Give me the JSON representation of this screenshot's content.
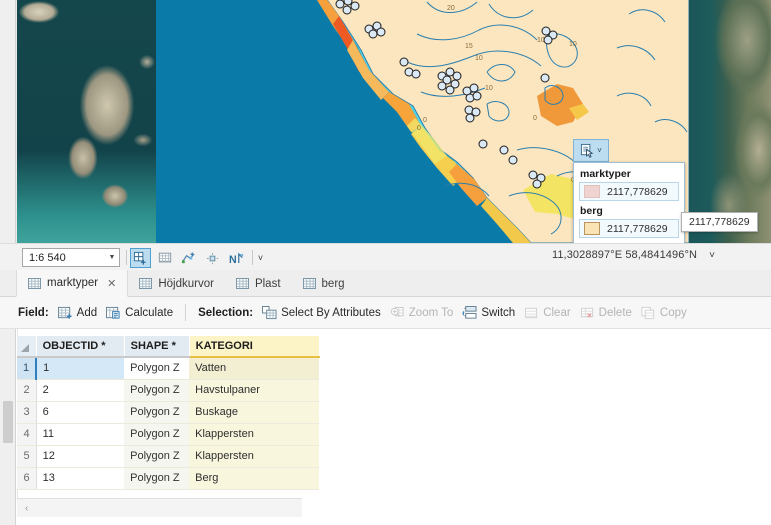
{
  "map": {
    "identify_button": {
      "icon": "identify-tool-icon",
      "caret": "˅"
    },
    "identify_panel": {
      "groups": [
        {
          "layer": "marktyper",
          "swatch_color": "#efd3d0",
          "value": "2117,778629"
        },
        {
          "layer": "berg",
          "swatch_color": "#fae3b4",
          "value": "2117,778629"
        }
      ]
    },
    "tooltip": "2117,778629",
    "contour_labels": [
      "20",
      "15",
      "10",
      "10",
      "10",
      "10",
      "0",
      "0",
      "0"
    ]
  },
  "status": {
    "scale": "1:6 540",
    "scale_dropdown_icon": "chevron-down-icon",
    "coordinates": "11,3028897°E 58,4841496°N",
    "coordinates_caret": "˅",
    "tools": [
      {
        "name": "select-features-tool",
        "active": true
      },
      {
        "name": "grid-tool",
        "active": false
      },
      {
        "name": "edit-vertices-tool",
        "active": false
      },
      {
        "name": "snapping-tool",
        "active": false
      },
      {
        "name": "north-arrow-tool",
        "active": false
      },
      {
        "name": "overflow-chevron",
        "active": false,
        "label": "˅"
      }
    ]
  },
  "table_tabs": [
    {
      "label": "marktyper",
      "active": true,
      "closable": true,
      "close_glyph": "✕"
    },
    {
      "label": "Höjdkurvor",
      "active": false,
      "closable": false
    },
    {
      "label": "Plast",
      "active": false,
      "closable": false
    },
    {
      "label": "berg",
      "active": false,
      "closable": false
    }
  ],
  "fieldbar": {
    "field_label": "Field:",
    "field_actions": [
      {
        "label": "Add",
        "icon": "add-field-icon",
        "enabled": true
      },
      {
        "label": "Calculate",
        "icon": "calculate-field-icon",
        "enabled": true
      }
    ],
    "selection_label": "Selection:",
    "selection_actions": [
      {
        "label": "Select By Attributes",
        "icon": "select-by-attributes-icon",
        "enabled": true
      },
      {
        "label": "Zoom To",
        "icon": "zoom-to-icon",
        "enabled": false
      },
      {
        "label": "Switch",
        "icon": "switch-selection-icon",
        "enabled": true
      },
      {
        "label": "Clear",
        "icon": "clear-selection-icon",
        "enabled": false
      },
      {
        "label": "Delete",
        "icon": "delete-selection-icon",
        "enabled": false
      },
      {
        "label": "Copy",
        "icon": "copy-selection-icon",
        "enabled": false
      }
    ]
  },
  "attribute_table": {
    "columns": [
      {
        "label": "OBJECTID *",
        "highlight": false
      },
      {
        "label": "SHAPE *",
        "highlight": false
      },
      {
        "label": "KATEGORI",
        "highlight": true
      }
    ],
    "rows": [
      {
        "num": "1",
        "objectid": "1",
        "shape": "Polygon Z",
        "kategori": "Vatten",
        "selected": true
      },
      {
        "num": "2",
        "objectid": "2",
        "shape": "Polygon Z",
        "kategori": "Havstulpaner",
        "selected": false
      },
      {
        "num": "3",
        "objectid": "6",
        "shape": "Polygon Z",
        "kategori": "Buskage",
        "selected": false
      },
      {
        "num": "4",
        "objectid": "11",
        "shape": "Polygon Z",
        "kategori": "Klappersten",
        "selected": false
      },
      {
        "num": "5",
        "objectid": "12",
        "shape": "Polygon Z",
        "kategori": "Klappersten",
        "selected": false
      },
      {
        "num": "6",
        "objectid": "13",
        "shape": "Polygon Z",
        "kategori": "Berg",
        "selected": false
      }
    ],
    "bottom_scroll_glyph": "‹"
  }
}
